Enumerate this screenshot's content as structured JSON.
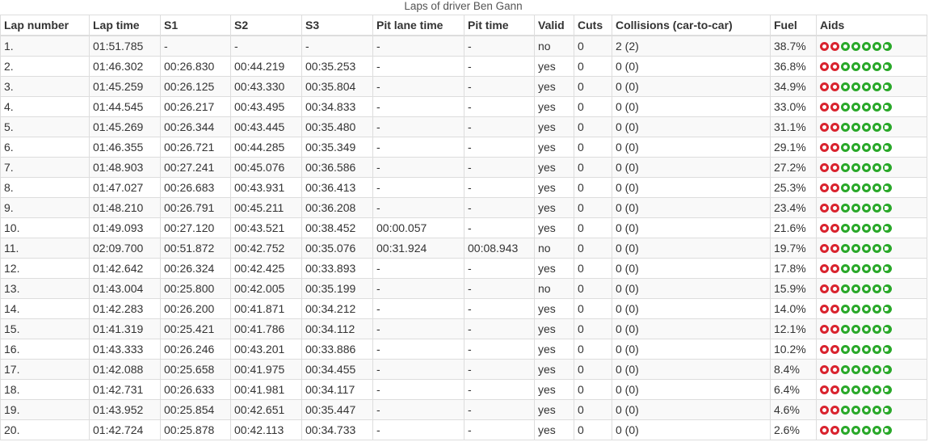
{
  "caption": "Laps of driver Ben Gann",
  "colors": {
    "aid_red": "#d9232e",
    "aid_green": "#29a829",
    "highlight": "#d9001b"
  },
  "columns": [
    "Lap number",
    "Lap time",
    "S1",
    "S2",
    "S3",
    "Pit lane time",
    "Pit time",
    "Valid",
    "Cuts",
    "Collisions (car-to-car)",
    "Fuel",
    "Aids"
  ],
  "aids_icons": [
    "red-aid-icon",
    "red-aid-icon",
    "green-aid-icon",
    "green-aid-icon",
    "green-aid-icon",
    "green-aid-icon",
    "green-aid-icon"
  ],
  "rows": [
    [
      "1.",
      "01:51.785",
      "-",
      "-",
      "-",
      "-",
      "-",
      "no",
      "0",
      "2 (2)",
      "38.7%"
    ],
    [
      "2.",
      "01:46.302",
      "00:26.830",
      "00:44.219",
      "00:35.253",
      "-",
      "-",
      "yes",
      "0",
      "0 (0)",
      "36.8%"
    ],
    [
      "3.",
      "01:45.259",
      "00:26.125",
      "00:43.330",
      "00:35.804",
      "-",
      "-",
      "yes",
      "0",
      "0 (0)",
      "34.9%"
    ],
    [
      "4.",
      "01:44.545",
      "00:26.217",
      "00:43.495",
      "00:34.833",
      "-",
      "-",
      "yes",
      "0",
      "0 (0)",
      "33.0%"
    ],
    [
      "5.",
      "01:45.269",
      "00:26.344",
      "00:43.445",
      "00:35.480",
      "-",
      "-",
      "yes",
      "0",
      "0 (0)",
      "31.1%"
    ],
    [
      "6.",
      "01:46.355",
      "00:26.721",
      "00:44.285",
      "00:35.349",
      "-",
      "-",
      "yes",
      "0",
      "0 (0)",
      "29.1%"
    ],
    [
      "7.",
      "01:48.903",
      "00:27.241",
      "00:45.076",
      "00:36.586",
      "-",
      "-",
      "yes",
      "0",
      "0 (0)",
      "27.2%"
    ],
    [
      "8.",
      "01:47.027",
      "00:26.683",
      "00:43.931",
      "00:36.413",
      "-",
      "-",
      "yes",
      "0",
      "0 (0)",
      "25.3%"
    ],
    [
      "9.",
      "01:48.210",
      "00:26.791",
      "00:45.211",
      "00:36.208",
      "-",
      "-",
      "yes",
      "0",
      "0 (0)",
      "23.4%"
    ],
    [
      "10.",
      "01:49.093",
      "00:27.120",
      "00:43.521",
      "00:38.452",
      "00:00.057",
      "-",
      "yes",
      "0",
      "0 (0)",
      "21.6%"
    ],
    [
      "11.",
      "02:09.700",
      "00:51.872",
      "00:42.752",
      "00:35.076",
      "00:31.924",
      "00:08.943",
      "no",
      "0",
      "0 (0)",
      "19.7%"
    ],
    [
      "12.",
      "01:42.642",
      "00:26.324",
      "00:42.425",
      "00:33.893",
      "-",
      "-",
      "yes",
      "0",
      "0 (0)",
      "17.8%"
    ],
    [
      "13.",
      "01:43.004",
      "00:25.800",
      "00:42.005",
      "00:35.199",
      "-",
      "-",
      "no",
      "0",
      "0 (0)",
      "15.9%"
    ],
    [
      "14.",
      "01:42.283",
      "00:26.200",
      "00:41.871",
      "00:34.212",
      "-",
      "-",
      "yes",
      "0",
      "0 (0)",
      "14.0%"
    ],
    [
      "15.",
      "01:41.319",
      "00:25.421",
      "00:41.786",
      "00:34.112",
      "-",
      "-",
      "yes",
      "0",
      "0 (0)",
      "12.1%"
    ],
    [
      "16.",
      "01:43.333",
      "00:26.246",
      "00:43.201",
      "00:33.886",
      "-",
      "-",
      "yes",
      "0",
      "0 (0)",
      "10.2%"
    ],
    [
      "17.",
      "01:42.088",
      "00:25.658",
      "00:41.975",
      "00:34.455",
      "-",
      "-",
      "yes",
      "0",
      "0 (0)",
      "8.4%"
    ],
    [
      "18.",
      "01:42.731",
      "00:26.633",
      "00:41.981",
      "00:34.117",
      "-",
      "-",
      "yes",
      "0",
      "0 (0)",
      "6.4%"
    ],
    [
      "19.",
      "01:43.952",
      "00:25.854",
      "00:42.651",
      "00:35.447",
      "-",
      "-",
      "yes",
      "0",
      "0 (0)",
      "4.6%"
    ],
    [
      "20.",
      "01:42.724",
      "00:25.878",
      "00:42.113",
      "00:34.733",
      "-",
      "-",
      "yes",
      "0",
      "0 (0)",
      "2.6%"
    ]
  ],
  "highlighted_row_index": 10
}
